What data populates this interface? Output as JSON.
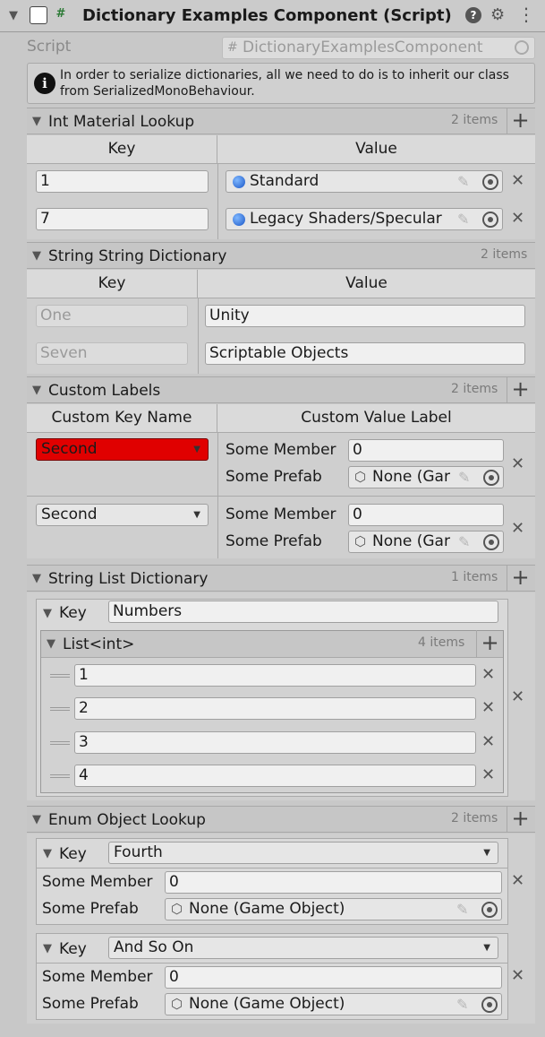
{
  "header": {
    "title": "Dictionary Examples Component (Script)"
  },
  "script_row": {
    "label": "Script",
    "value": "DictionaryExamplesComponent"
  },
  "info": {
    "line1": "In order to serialize dictionaries, all we need to do is to inherit our class",
    "line2": "from SerializedMonoBehaviour."
  },
  "int_material": {
    "title": "Int Material Lookup",
    "count": "2 items",
    "key_header": "Key",
    "value_header": "Value",
    "rows": [
      {
        "key": "1",
        "value": "Standard"
      },
      {
        "key": "7",
        "value": "Legacy Shaders/Specular"
      }
    ]
  },
  "string_string": {
    "title": "String String Dictionary",
    "count": "2 items",
    "key_header": "Key",
    "value_header": "Value",
    "rows": [
      {
        "key": "One",
        "value": "Unity"
      },
      {
        "key": "Seven",
        "value": "Scriptable Objects"
      }
    ]
  },
  "custom_labels": {
    "title": "Custom Labels",
    "count": "2 items",
    "key_header": "Custom Key Name",
    "value_header": "Custom Value Label",
    "member_label": "Some Member",
    "prefab_label": "Some Prefab",
    "rows": [
      {
        "key": "Second",
        "member": "0",
        "prefab": "None (Gar"
      },
      {
        "key": "Second",
        "member": "0",
        "prefab": "None (Gar"
      }
    ],
    "error_color": "#e00000"
  },
  "string_list": {
    "title": "String List Dictionary",
    "count": "1 items",
    "key_label": "Key",
    "key_value": "Numbers",
    "list_title": "List<int>",
    "list_count": "4 items",
    "values": [
      "1",
      "2",
      "3",
      "4"
    ]
  },
  "enum_object": {
    "title": "Enum Object Lookup",
    "count": "2 items",
    "key_label": "Key",
    "member_label": "Some Member",
    "prefab_label": "Some Prefab",
    "entries": [
      {
        "key": "Fourth",
        "member": "0",
        "prefab": "None (Game Object)"
      },
      {
        "key": "And So On",
        "member": "0",
        "prefab": "None (Game Object)"
      }
    ]
  }
}
